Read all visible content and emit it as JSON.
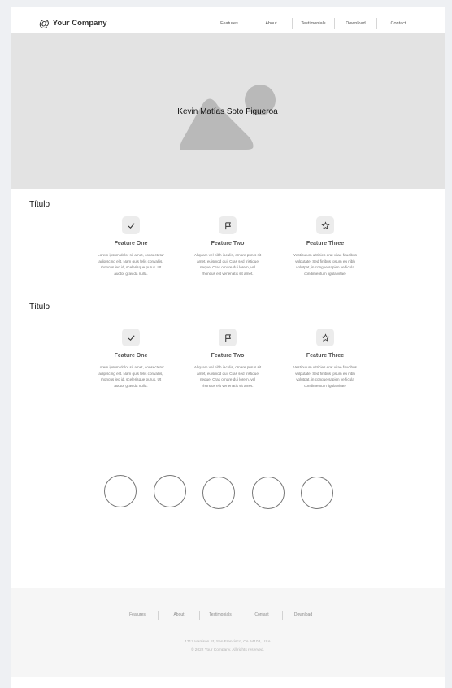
{
  "header": {
    "brand_icon": "@",
    "brand_name": "Your Company",
    "nav": [
      "Features",
      "About",
      "Testimonials",
      "Download",
      "Contact"
    ]
  },
  "hero": {
    "title": "Kevin Matías Soto Figueroa",
    "icon": "image-placeholder-icon"
  },
  "sections": [
    {
      "title": "Título",
      "features": [
        {
          "icon": "check-icon",
          "title": "Feature One",
          "desc": "Lorem ipsum dolor sit amet, consectetur adipiscing elit. Nam quis felis convallis, rhoncus leo id, scelerisque purus. Ut auctor gravida nulla."
        },
        {
          "icon": "flag-icon",
          "title": "Feature Two",
          "desc": "Aliquam vel nibh iaculis, ornare purus sit amet, euismod dui. Cras sed tristique neque. Cras ornare dui lorem, vel rhoncus elit venenatis sit amet."
        },
        {
          "icon": "star-icon",
          "title": "Feature Three",
          "desc": "Vestibulum ultricies erat vitae faucibus vulputate. Sed finibus ipsum eu nibh volutpat, in congue sapien vehicula condimentum ligula vitae."
        }
      ]
    },
    {
      "title": "Título",
      "features": [
        {
          "icon": "check-icon",
          "title": "Feature One",
          "desc": "Lorem ipsum dolor sit amet, consectetur adipiscing elit. Nam quis felis convallis, rhoncus leo id, scelerisque purus. Ut auctor gravida nulla."
        },
        {
          "icon": "flag-icon",
          "title": "Feature Two",
          "desc": "Aliquam vel nibh iaculis, ornare purus sit amet, euismod dui. Cras sed tristique neque. Cras ornare dui lorem, vel rhoncus elit venenatis sit amet."
        },
        {
          "icon": "star-icon",
          "title": "Feature Three",
          "desc": "Vestibulum ultricies erat vitae faucibus vulputate. Sed finibus ipsum eu nibh volutpat, in congue sapien vehicula condimentum ligula vitae."
        }
      ]
    }
  ],
  "footer": {
    "nav": [
      "Features",
      "About",
      "Testimonials",
      "Contact",
      "Download"
    ],
    "address": "1717 Harrison St, San Francisco, CA 94103, USA",
    "copyright": "© 2022 Your Company.  All rights reserved."
  }
}
